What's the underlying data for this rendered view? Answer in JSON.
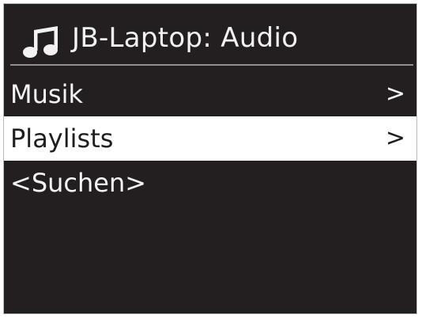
{
  "header": {
    "icon": "music-note-icon",
    "title": "JB-Laptop: Audio"
  },
  "menu": {
    "items": [
      {
        "label": "Musik",
        "chevron": ">",
        "selected": false
      },
      {
        "label": "Playlists",
        "chevron": ">",
        "selected": true
      },
      {
        "label": "<Suchen>",
        "chevron": "",
        "selected": false
      }
    ]
  },
  "colors": {
    "background": "#231f20",
    "text": "#f4f4f4",
    "selection_background": "#ffffff",
    "selection_text": "#1e1e1e",
    "divider": "#8f8f8f"
  }
}
